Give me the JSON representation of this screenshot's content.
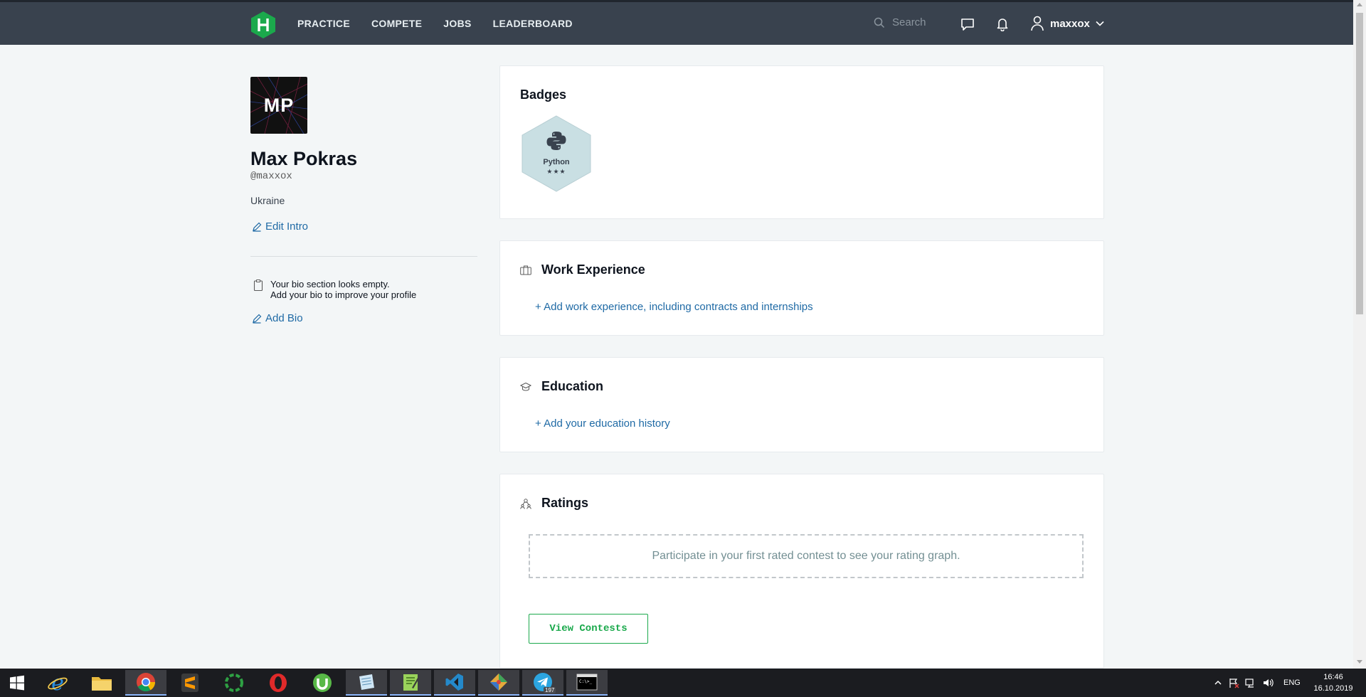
{
  "nav": {
    "links": [
      "PRACTICE",
      "COMPETE",
      "JOBS",
      "LEADERBOARD"
    ],
    "search_placeholder": "Search",
    "username": "maxxox"
  },
  "profile": {
    "initials": "MP",
    "name": "Max Pokras",
    "handle": "@maxxox",
    "country": "Ukraine",
    "edit_intro": "Edit Intro",
    "bio_empty_line1": "Your bio section looks empty.",
    "bio_empty_line2": "Add your bio to improve your profile",
    "add_bio": "Add Bio"
  },
  "badges": {
    "title": "Badges",
    "items": [
      {
        "name": "Python",
        "stars": "★★★"
      }
    ]
  },
  "work": {
    "title": "Work Experience",
    "add": "+ Add work experience, including contracts and internships"
  },
  "education": {
    "title": "Education",
    "add": "+ Add your education history"
  },
  "ratings": {
    "title": "Ratings",
    "empty": "Participate in your first rated contest to see your rating graph.",
    "button": "View Contests"
  },
  "taskbar": {
    "lang": "ENG",
    "time": "16:46",
    "date": "16.10.2019",
    "telegram_count": "197"
  },
  "colors": {
    "nav_bg": "#39424e",
    "brand_green": "#1ba94c",
    "link_blue": "#1f6aa5",
    "page_bg": "#f3f6f7"
  }
}
